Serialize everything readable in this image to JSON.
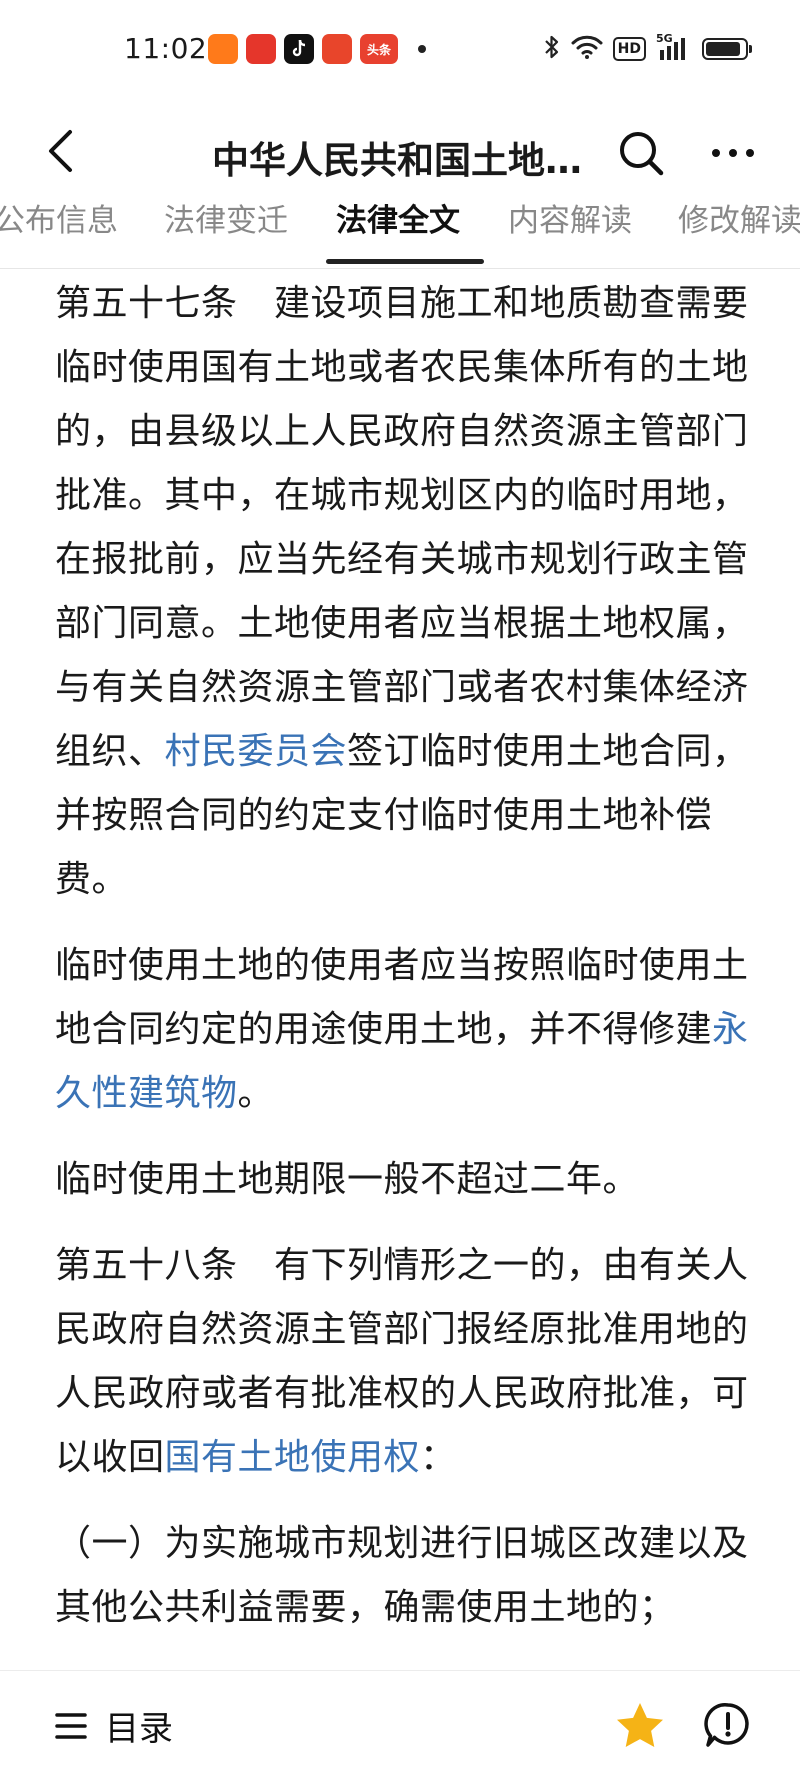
{
  "status_bar": {
    "time": "11:02",
    "app_icons": [
      {
        "name": "notification-app-icon",
        "label": "",
        "color": "#ff7a1a"
      },
      {
        "name": "map-app-icon",
        "label": "",
        "color": "#e5362b"
      },
      {
        "name": "tiktok-icon",
        "label": "",
        "color": "#111111"
      },
      {
        "name": "shopping-app-icon",
        "label": "",
        "color": "#e8452b"
      },
      {
        "name": "toutiao-icon",
        "label": "头条",
        "color": "#e8412f"
      }
    ],
    "network_badge": "HD",
    "signal_label": "5G",
    "battery_level": 0.9
  },
  "header": {
    "title": "中华人民共和国土地…"
  },
  "tabs": [
    {
      "label": "公布信息",
      "active": false
    },
    {
      "label": "法律变迁",
      "active": false
    },
    {
      "label": "法律全文",
      "active": true
    },
    {
      "label": "内容解读",
      "active": false
    },
    {
      "label": "修改解读",
      "active": false
    }
  ],
  "article": {
    "p1": {
      "t1": "第五十七条　建设项目施工和地质勘查需要临时使用国有土地或者农民集体所有的土地的，由县级以上人民政府自然资源主管部门批准。其中，在城市规划区内的临时用地，在报批前，应当先经有关城市规划行政主管部门同意。土地使用者应当根据土地权属，与有关自然资源主管部门或者农村集体经济组织、",
      "link": "村民委员会",
      "t2": "签订临时使用土地合同，并按照合同的约定支付临时使用土地补偿费。"
    },
    "p2": {
      "t1": "临时使用土地的使用者应当按照临时使用土地合同约定的用途使用土地，并不得修建",
      "link": "永久性建筑物",
      "t2": "。"
    },
    "p3": "临时使用土地期限一般不超过二年。",
    "p4": {
      "t1": "第五十八条　有下列情形之一的，由有关人民政府自然资源主管部门报经原批准用地的人民政府或者有批准权的人民政府批准，可以收回",
      "link": "国有土地使用权",
      "t2": "："
    },
    "p5": "（一）为实施城市规划进行旧城区改建以及其他公共利益需要，确需使用土地的；"
  },
  "bottom_bar": {
    "menu_label": "目录",
    "star_color": "#f5b316"
  },
  "colors": {
    "link": "#3a73b6",
    "text": "#1a1a1a",
    "inactive_tab": "#888888"
  }
}
